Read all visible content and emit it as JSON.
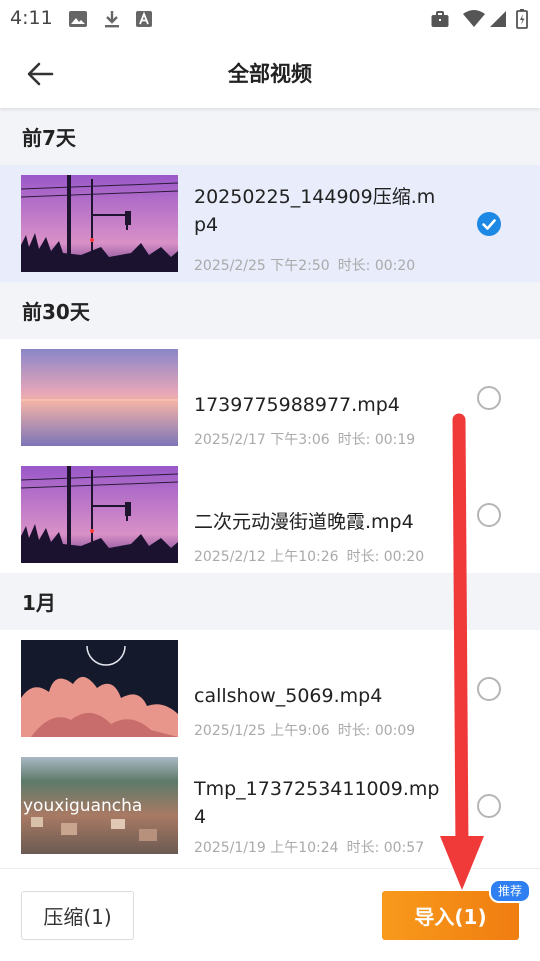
{
  "status_bar": {
    "time": "4:11",
    "left_icons": [
      "image-icon",
      "download-icon",
      "font-icon"
    ],
    "right_icons": [
      "briefcase-icon",
      "wifi-icon",
      "signal-icon",
      "battery-icon"
    ]
  },
  "header": {
    "title": "全部视频",
    "back_icon": "arrow-left-icon"
  },
  "sections": [
    {
      "title": "前7天",
      "items": [
        {
          "name": "20250225_144909压缩.mp4",
          "date": "2025/2/25 下午2:50",
          "duration": "时长: 00:20",
          "selected": true,
          "thumb": "purple-street"
        }
      ]
    },
    {
      "title": "前30天",
      "items": [
        {
          "name": "1739775988977.mp4",
          "date": "2025/2/17 下午3:06",
          "duration": "时长: 00:19",
          "selected": false,
          "thumb": "sunset-sea"
        },
        {
          "name": "二次元动漫街道晚霞.mp4",
          "date": "2025/2/12 上午10:26",
          "duration": "时长: 00:20",
          "selected": false,
          "thumb": "purple-street"
        }
      ]
    },
    {
      "title": "1月",
      "items": [
        {
          "name": "callshow_5069.mp4",
          "date": "2025/1/25 上午9:06",
          "duration": "时长: 00:09",
          "selected": false,
          "thumb": "pink-clouds"
        },
        {
          "name": "Tmp_1737253411009.mp4",
          "date": "2025/1/19 上午10:24",
          "duration": "时长: 00:57",
          "selected": false,
          "thumb": "aerial-town",
          "thumb_text": "youxiguancha"
        }
      ]
    }
  ],
  "bottom": {
    "compress_label": "压缩(1)",
    "import_label": "导入(1)",
    "badge": "推荐"
  },
  "colors": {
    "accent": "#1e88e5",
    "import_gradient_start": "#f89a1c",
    "import_gradient_end": "#f07d10",
    "badge": "#2f7ff2",
    "selected_row": "#e8ecfb",
    "section_bg": "#f3f4f8",
    "annotation_arrow": "#f03a3a"
  }
}
